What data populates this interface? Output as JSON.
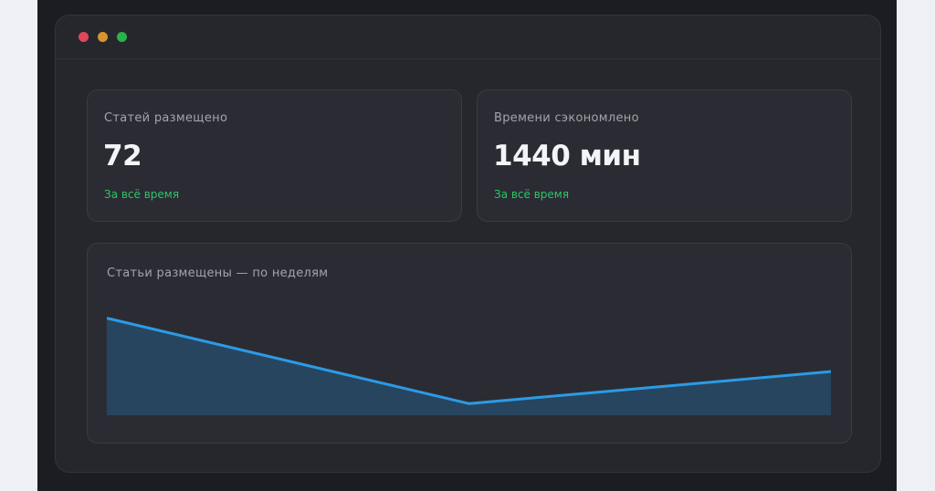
{
  "window": {
    "controls": [
      {
        "name": "close",
        "color": "#e0475a"
      },
      {
        "name": "minimize",
        "color": "#d9952b"
      },
      {
        "name": "maximize",
        "color": "#29b34a"
      }
    ]
  },
  "stats": [
    {
      "label": "Статей размещено",
      "value": "72",
      "note": "За всё время"
    },
    {
      "label": "Времени сэкономлено",
      "value": "1440 мин",
      "note": "За всё время"
    }
  ],
  "chart": {
    "title": "Статьи размещены — по неделям"
  },
  "chart_data": {
    "type": "area",
    "title": "Статьи размещены — по неделям",
    "x": [
      1,
      2,
      3
    ],
    "series": [
      {
        "values": [
          1.0,
          0.12,
          0.45
        ]
      }
    ],
    "ylim": [
      0,
      1.1
    ],
    "grid": false,
    "line_color": "#2b9be6",
    "fill_color": "#28455f"
  }
}
